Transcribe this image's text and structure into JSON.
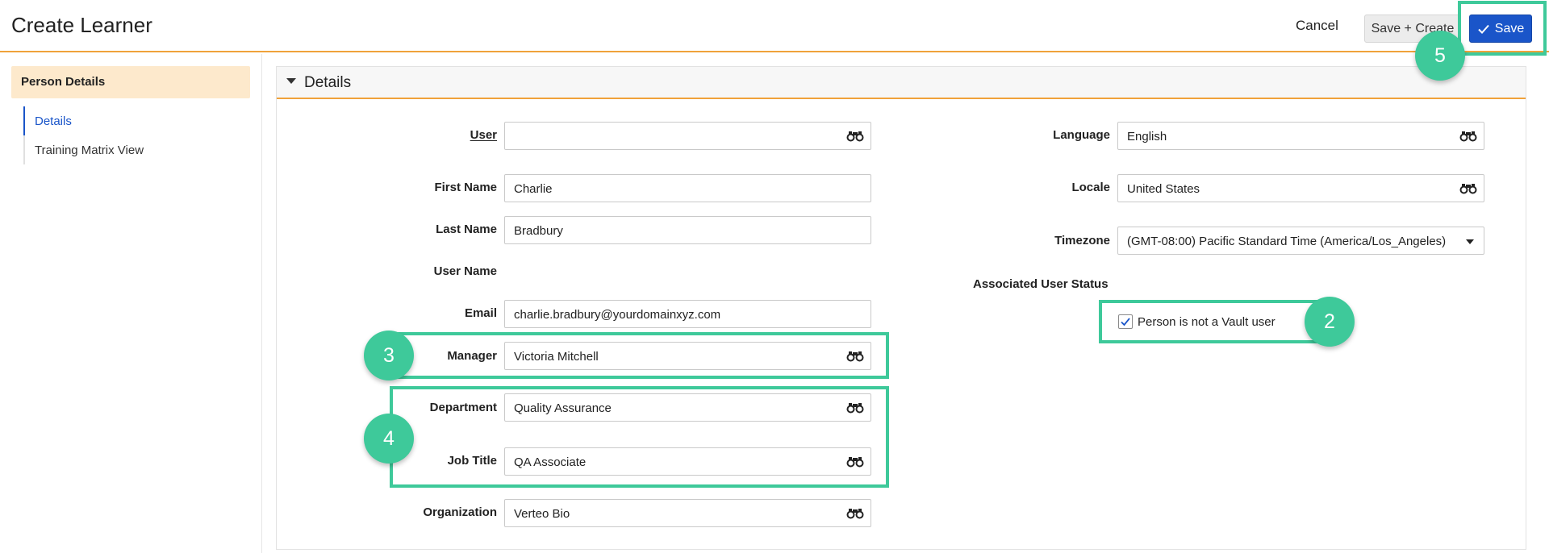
{
  "header": {
    "title": "Create Learner",
    "cancel_label": "Cancel",
    "save_create_label": "Save + Create",
    "save_label": "Save"
  },
  "sidebar": {
    "section_title": "Person Details",
    "items": [
      {
        "label": "Details",
        "active": true
      },
      {
        "label": "Training Matrix View",
        "active": false
      }
    ]
  },
  "panel": {
    "title": "Details"
  },
  "form_left": {
    "user": {
      "label": "User",
      "value": ""
    },
    "first_name": {
      "label": "First Name",
      "value": "Charlie"
    },
    "last_name": {
      "label": "Last Name",
      "value": "Bradbury"
    },
    "user_name": {
      "label": "User Name",
      "value": ""
    },
    "email": {
      "label": "Email",
      "value": "charlie.bradbury@yourdomainxyz.com"
    },
    "manager": {
      "label": "Manager",
      "value": "Victoria Mitchell"
    },
    "department": {
      "label": "Department",
      "value": "Quality Assurance"
    },
    "job_title": {
      "label": "Job Title",
      "value": "QA Associate"
    },
    "organization": {
      "label": "Organization",
      "value": "Verteo Bio"
    }
  },
  "form_right": {
    "language": {
      "label": "Language",
      "value": "English"
    },
    "locale": {
      "label": "Locale",
      "value": "United States"
    },
    "timezone": {
      "label": "Timezone",
      "value": "(GMT-08:00) Pacific Standard Time (America/Los_Angeles)"
    },
    "associated_status": {
      "label": "Associated User Status"
    },
    "not_vault_user": {
      "label": "Person is not a Vault user",
      "checked": true
    }
  },
  "callouts": {
    "save": "5",
    "vault_user": "2",
    "manager": "3",
    "dept_job": "4"
  },
  "colors": {
    "accent": "#f0a23a",
    "primary": "#1a55c9",
    "highlight": "#3ec99a",
    "sidebar_section_bg": "#fde9cc"
  },
  "icons": {
    "lookup": "binoculars-icon",
    "save": "check-icon",
    "section_toggle": "caret-down-icon",
    "dropdown": "chevron-down-icon"
  }
}
